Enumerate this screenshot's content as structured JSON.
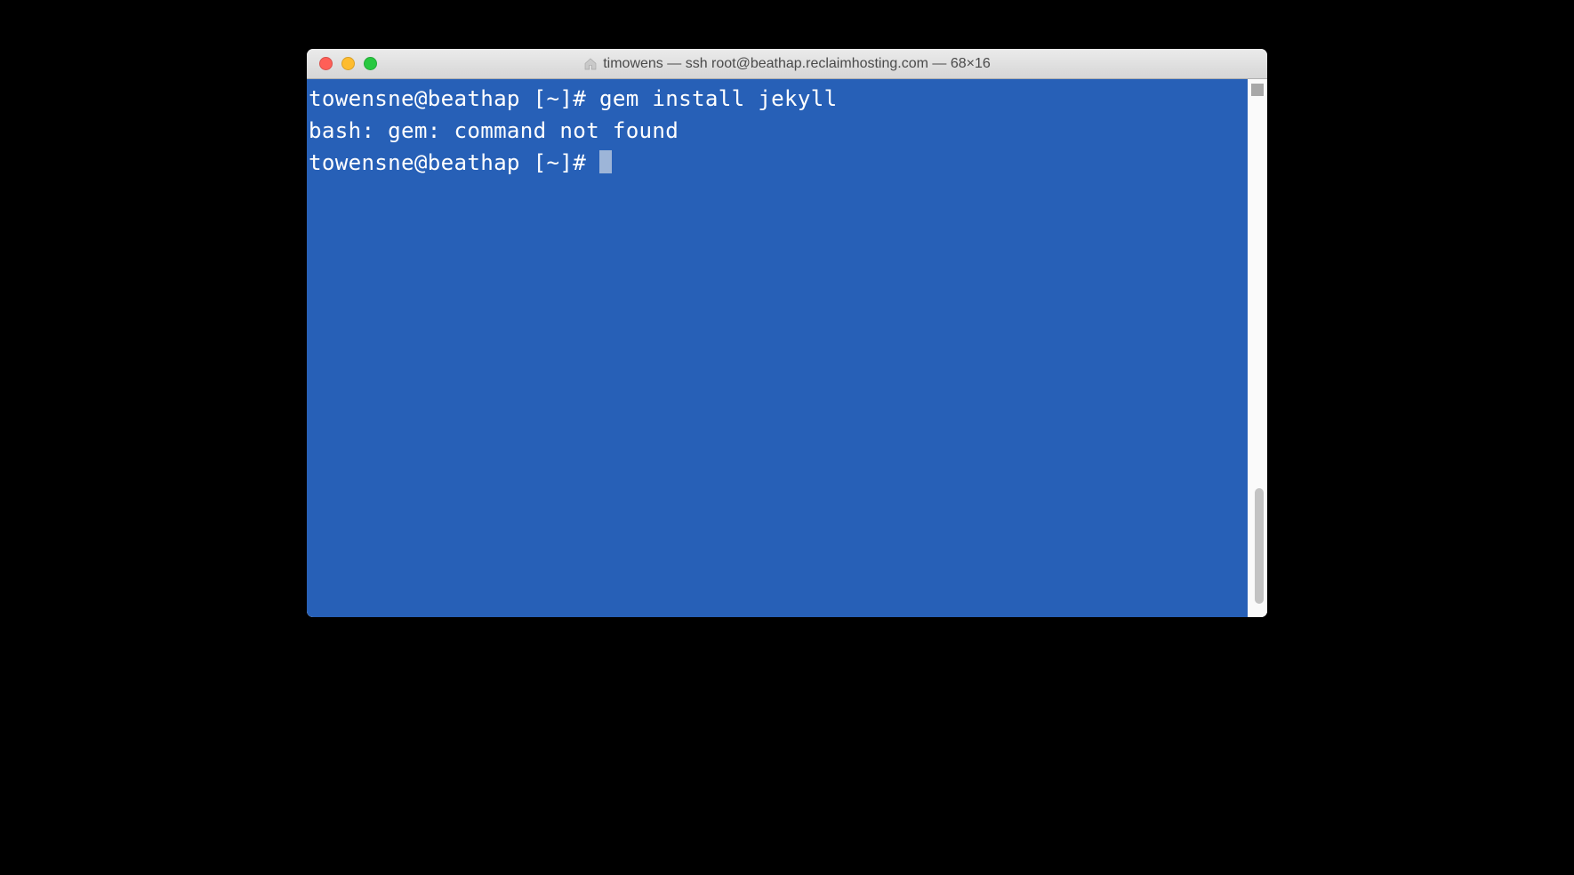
{
  "window": {
    "title": "timowens — ssh root@beathap.reclaimhosting.com — 68×16"
  },
  "terminal": {
    "lines": [
      {
        "prompt": "towensne@beathap [~]# ",
        "command": "gem install jekyll"
      },
      {
        "output": "bash: gem: command not found"
      },
      {
        "prompt": "towensne@beathap [~]# ",
        "cursor": true
      }
    ],
    "background": "#2760b7",
    "foreground": "#ffffff"
  }
}
